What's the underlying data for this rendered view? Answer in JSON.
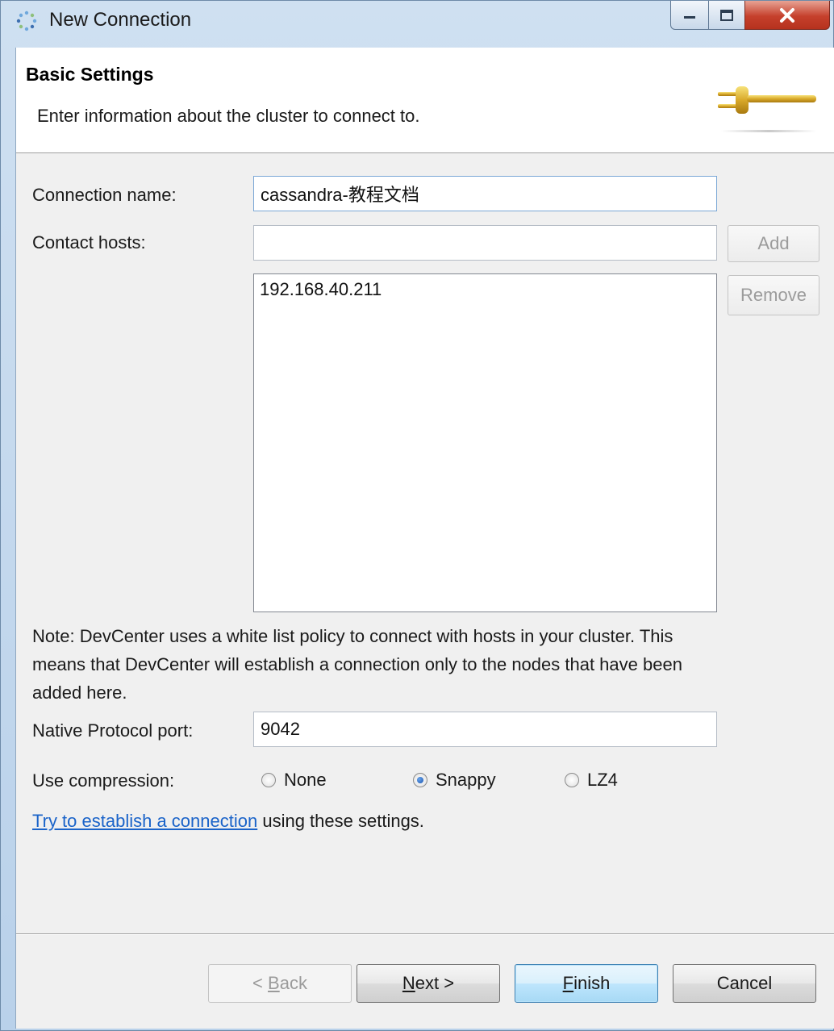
{
  "window": {
    "title": "New Connection"
  },
  "header": {
    "title": "Basic Settings",
    "description": "Enter information about the cluster to connect to."
  },
  "form": {
    "connection_name_label": "Connection name:",
    "connection_name_value": "cassandra-教程文档",
    "contact_hosts_label": "Contact hosts:",
    "contact_hosts_value": "",
    "add_button": "Add",
    "remove_button": "Remove",
    "hosts": [
      "192.168.40.211"
    ],
    "note": "Note: DevCenter uses a white list policy to connect with hosts in your cluster. This means that DevCenter will establish a connection only to the nodes that have been added here.",
    "port_label": "Native Protocol port:",
    "port_value": "9042",
    "compression_label": "Use compression:",
    "compression_options": [
      {
        "label": "None",
        "selected": false
      },
      {
        "label": "Snappy",
        "selected": true
      },
      {
        "label": "LZ4",
        "selected": false
      }
    ],
    "test_link": "Try to establish a connection",
    "test_link_suffix": " using these settings."
  },
  "footer": {
    "back_prefix": "< ",
    "back_mnemonic": "B",
    "back_rest": "ack",
    "next_mnemonic": "N",
    "next_rest": "ext >",
    "finish_mnemonic": "F",
    "finish_rest": "inish",
    "cancel": "Cancel"
  },
  "colors": {
    "titlebar": "#cfe0f1",
    "link": "#1a63c9",
    "close_button": "#c5402c",
    "default_button_border": "#3c7fb1"
  },
  "icons": [
    "dots-app-icon",
    "minimize-icon",
    "maximize-icon",
    "close-icon",
    "plug-icon"
  ]
}
